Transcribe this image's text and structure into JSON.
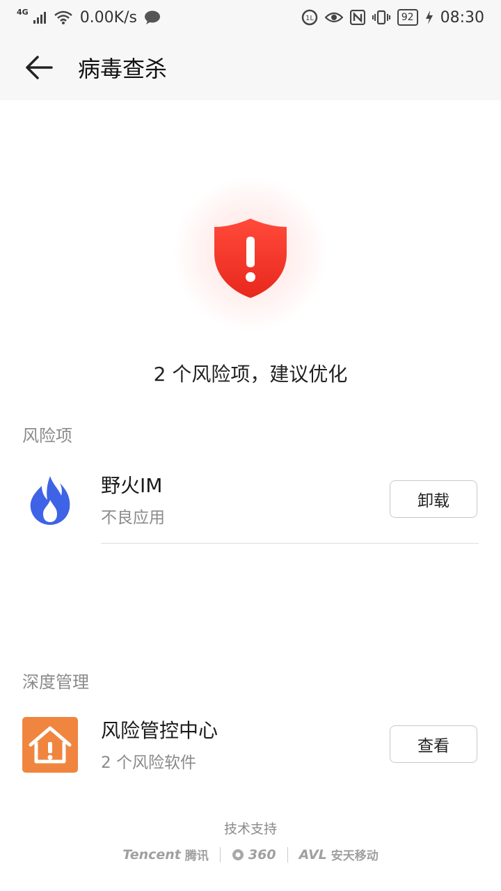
{
  "status_bar": {
    "network_type": "4G",
    "speed": "0.00K/s",
    "battery": "92",
    "time": "08:30"
  },
  "header": {
    "title": "病毒查杀"
  },
  "scan": {
    "summary": "2 个风险项，建议优化"
  },
  "risk_section": {
    "label": "风险项",
    "items": [
      {
        "name": "野火IM",
        "desc": "不良应用",
        "action": "卸载",
        "icon": "flame-icon"
      }
    ]
  },
  "deep_section": {
    "label": "深度管理",
    "items": [
      {
        "name": "风险管控中心",
        "desc": "2 个风险软件",
        "action": "查看",
        "icon": "house-warning-icon"
      }
    ]
  },
  "footer": {
    "label": "技术支持",
    "partners": [
      {
        "latin": "Tencent",
        "cn": "腾讯"
      },
      {
        "latin": "360",
        "cn": ""
      },
      {
        "latin": "AVL",
        "cn": "安天移动"
      }
    ]
  },
  "colors": {
    "danger": "#f03a2e",
    "accent_orange": "#f0853f",
    "flame_blue": "#3f63e6"
  }
}
